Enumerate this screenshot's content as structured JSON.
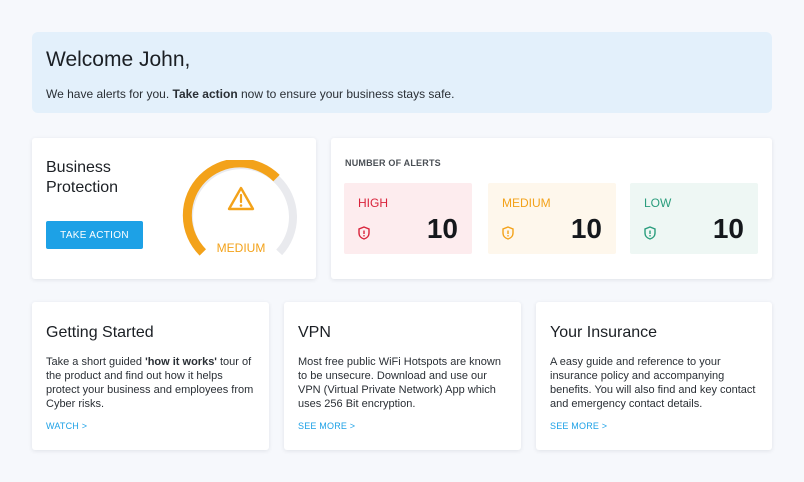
{
  "welcome": {
    "title": "Welcome John,",
    "message_prefix": "We have alerts for you. ",
    "message_bold": "Take action",
    "message_suffix": " now to ensure your business stays safe."
  },
  "business_protection": {
    "title": "Business Protection",
    "button_label": "TAKE ACTION",
    "gauge_label": "MEDIUM",
    "gauge_icon": "warning-triangle-icon",
    "colors": {
      "gauge_fill": "#f3a21a",
      "gauge_track": "#e9eaee",
      "button": "#1da1e6"
    }
  },
  "alerts": {
    "title": "NUMBER OF ALERTS",
    "items": [
      {
        "label": "HIGH",
        "count": "10",
        "icon": "shield-alert-icon",
        "color": "#d9233b"
      },
      {
        "label": "MEDIUM",
        "count": "10",
        "icon": "shield-alert-icon",
        "color": "#f3a21a"
      },
      {
        "label": "LOW",
        "count": "10",
        "icon": "shield-alert-icon",
        "color": "#2a9d7d"
      }
    ]
  },
  "cards": [
    {
      "title": "Getting Started",
      "text_prefix": "Take a short guided ",
      "text_bold": "'how it works'",
      "text_suffix": " tour of the product and find out how it helps protect your business and employees from Cyber risks.",
      "link": "WATCH >"
    },
    {
      "title": "VPN",
      "text": "Most free public WiFi Hotspots are known to be unsecure. Download and use our VPN (Virtual Private Network) App which uses 256 Bit encryption.",
      "link": "SEE MORE >"
    },
    {
      "title": "Your Insurance",
      "text": "A easy guide and reference to your insurance policy and accompanying benefits.  You will also find and key contact and emergency contact details.",
      "link": "SEE MORE >"
    }
  ]
}
